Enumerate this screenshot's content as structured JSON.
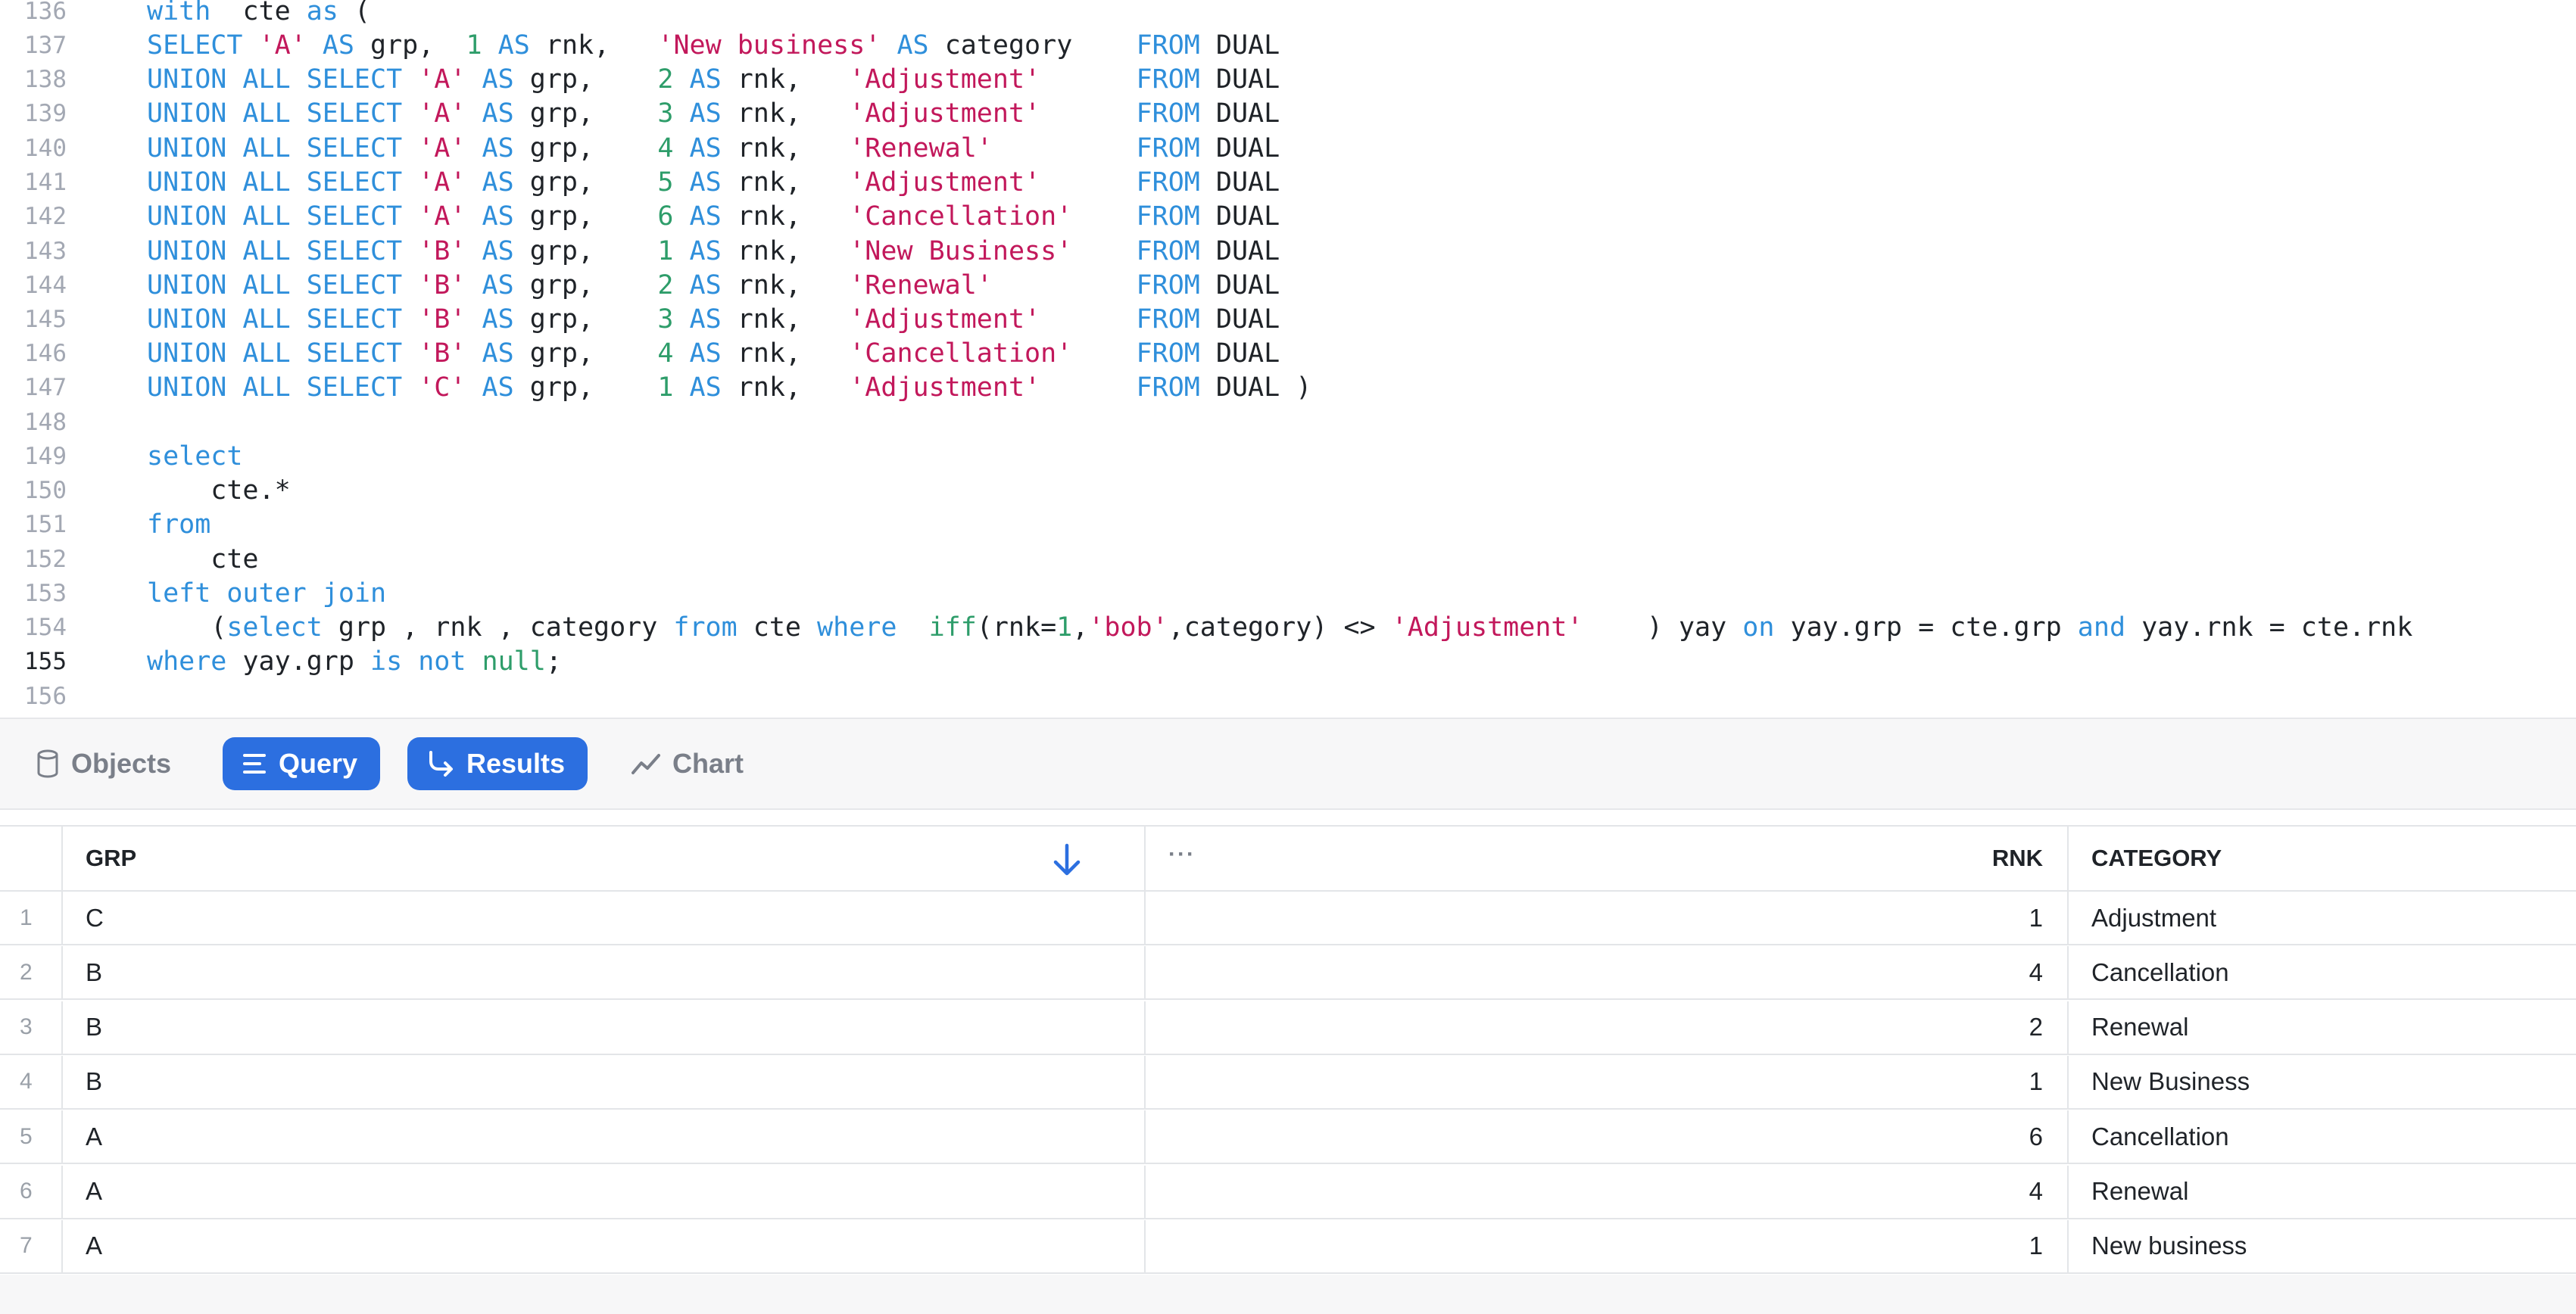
{
  "editor": {
    "lines": [
      {
        "n": "136",
        "tokens": [
          [
            "kw",
            "with"
          ],
          [
            "",
            "  cte "
          ],
          [
            "kw",
            "as"
          ],
          [
            "",
            " ("
          ]
        ]
      },
      {
        "n": "137",
        "tokens": [
          [
            "kw",
            "SELECT"
          ],
          [
            "",
            " "
          ],
          [
            "str",
            "'A'"
          ],
          [
            "",
            " "
          ],
          [
            "kw",
            "AS"
          ],
          [
            "",
            " grp,  "
          ],
          [
            "num",
            "1"
          ],
          [
            "",
            " "
          ],
          [
            "kw",
            "AS"
          ],
          [
            "",
            " rnk,   "
          ],
          [
            "str",
            "'New business'"
          ],
          [
            "",
            " "
          ],
          [
            "kw",
            "AS"
          ],
          [
            "",
            " category    "
          ],
          [
            "kw",
            "FROM"
          ],
          [
            "",
            " DUAL"
          ]
        ]
      },
      {
        "n": "138",
        "tokens": [
          [
            "kw",
            "UNION ALL SELECT"
          ],
          [
            "",
            " "
          ],
          [
            "str",
            "'A'"
          ],
          [
            "",
            " "
          ],
          [
            "kw",
            "AS"
          ],
          [
            "",
            " grp,    "
          ],
          [
            "num",
            "2"
          ],
          [
            "",
            " "
          ],
          [
            "kw",
            "AS"
          ],
          [
            "",
            " rnk,   "
          ],
          [
            "str",
            "'Adjustment'"
          ],
          [
            "",
            "      "
          ],
          [
            "kw",
            "FROM"
          ],
          [
            "",
            " DUAL"
          ]
        ]
      },
      {
        "n": "139",
        "tokens": [
          [
            "kw",
            "UNION ALL SELECT"
          ],
          [
            "",
            " "
          ],
          [
            "str",
            "'A'"
          ],
          [
            "",
            " "
          ],
          [
            "kw",
            "AS"
          ],
          [
            "",
            " grp,    "
          ],
          [
            "num",
            "3"
          ],
          [
            "",
            " "
          ],
          [
            "kw",
            "AS"
          ],
          [
            "",
            " rnk,   "
          ],
          [
            "str",
            "'Adjustment'"
          ],
          [
            "",
            "      "
          ],
          [
            "kw",
            "FROM"
          ],
          [
            "",
            " DUAL"
          ]
        ]
      },
      {
        "n": "140",
        "tokens": [
          [
            "kw",
            "UNION ALL SELECT"
          ],
          [
            "",
            " "
          ],
          [
            "str",
            "'A'"
          ],
          [
            "",
            " "
          ],
          [
            "kw",
            "AS"
          ],
          [
            "",
            " grp,    "
          ],
          [
            "num",
            "4"
          ],
          [
            "",
            " "
          ],
          [
            "kw",
            "AS"
          ],
          [
            "",
            " rnk,   "
          ],
          [
            "str",
            "'Renewal'"
          ],
          [
            "",
            "         "
          ],
          [
            "kw",
            "FROM"
          ],
          [
            "",
            " DUAL"
          ]
        ]
      },
      {
        "n": "141",
        "tokens": [
          [
            "kw",
            "UNION ALL SELECT"
          ],
          [
            "",
            " "
          ],
          [
            "str",
            "'A'"
          ],
          [
            "",
            " "
          ],
          [
            "kw",
            "AS"
          ],
          [
            "",
            " grp,    "
          ],
          [
            "num",
            "5"
          ],
          [
            "",
            " "
          ],
          [
            "kw",
            "AS"
          ],
          [
            "",
            " rnk,   "
          ],
          [
            "str",
            "'Adjustment'"
          ],
          [
            "",
            "      "
          ],
          [
            "kw",
            "FROM"
          ],
          [
            "",
            " DUAL"
          ]
        ]
      },
      {
        "n": "142",
        "tokens": [
          [
            "kw",
            "UNION ALL SELECT"
          ],
          [
            "",
            " "
          ],
          [
            "str",
            "'A'"
          ],
          [
            "",
            " "
          ],
          [
            "kw",
            "AS"
          ],
          [
            "",
            " grp,    "
          ],
          [
            "num",
            "6"
          ],
          [
            "",
            " "
          ],
          [
            "kw",
            "AS"
          ],
          [
            "",
            " rnk,   "
          ],
          [
            "str",
            "'Cancellation'"
          ],
          [
            "",
            "    "
          ],
          [
            "kw",
            "FROM"
          ],
          [
            "",
            " DUAL"
          ]
        ]
      },
      {
        "n": "143",
        "tokens": [
          [
            "kw",
            "UNION ALL SELECT"
          ],
          [
            "",
            " "
          ],
          [
            "str",
            "'B'"
          ],
          [
            "",
            " "
          ],
          [
            "kw",
            "AS"
          ],
          [
            "",
            " grp,    "
          ],
          [
            "num",
            "1"
          ],
          [
            "",
            " "
          ],
          [
            "kw",
            "AS"
          ],
          [
            "",
            " rnk,   "
          ],
          [
            "str",
            "'New Business'"
          ],
          [
            "",
            "    "
          ],
          [
            "kw",
            "FROM"
          ],
          [
            "",
            " DUAL"
          ]
        ]
      },
      {
        "n": "144",
        "tokens": [
          [
            "kw",
            "UNION ALL SELECT"
          ],
          [
            "",
            " "
          ],
          [
            "str",
            "'B'"
          ],
          [
            "",
            " "
          ],
          [
            "kw",
            "AS"
          ],
          [
            "",
            " grp,    "
          ],
          [
            "num",
            "2"
          ],
          [
            "",
            " "
          ],
          [
            "kw",
            "AS"
          ],
          [
            "",
            " rnk,   "
          ],
          [
            "str",
            "'Renewal'"
          ],
          [
            "",
            "         "
          ],
          [
            "kw",
            "FROM"
          ],
          [
            "",
            " DUAL"
          ]
        ]
      },
      {
        "n": "145",
        "tokens": [
          [
            "kw",
            "UNION ALL SELECT"
          ],
          [
            "",
            " "
          ],
          [
            "str",
            "'B'"
          ],
          [
            "",
            " "
          ],
          [
            "kw",
            "AS"
          ],
          [
            "",
            " grp,    "
          ],
          [
            "num",
            "3"
          ],
          [
            "",
            " "
          ],
          [
            "kw",
            "AS"
          ],
          [
            "",
            " rnk,   "
          ],
          [
            "str",
            "'Adjustment'"
          ],
          [
            "",
            "      "
          ],
          [
            "kw",
            "FROM"
          ],
          [
            "",
            " DUAL"
          ]
        ]
      },
      {
        "n": "146",
        "tokens": [
          [
            "kw",
            "UNION ALL SELECT"
          ],
          [
            "",
            " "
          ],
          [
            "str",
            "'B'"
          ],
          [
            "",
            " "
          ],
          [
            "kw",
            "AS"
          ],
          [
            "",
            " grp,    "
          ],
          [
            "num",
            "4"
          ],
          [
            "",
            " "
          ],
          [
            "kw",
            "AS"
          ],
          [
            "",
            " rnk,   "
          ],
          [
            "str",
            "'Cancellation'"
          ],
          [
            "",
            "    "
          ],
          [
            "kw",
            "FROM"
          ],
          [
            "",
            " DUAL"
          ]
        ]
      },
      {
        "n": "147",
        "tokens": [
          [
            "kw",
            "UNION ALL SELECT"
          ],
          [
            "",
            " "
          ],
          [
            "str",
            "'C'"
          ],
          [
            "",
            " "
          ],
          [
            "kw",
            "AS"
          ],
          [
            "",
            " grp,    "
          ],
          [
            "num",
            "1"
          ],
          [
            "",
            " "
          ],
          [
            "kw",
            "AS"
          ],
          [
            "",
            " rnk,   "
          ],
          [
            "str",
            "'Adjustment'"
          ],
          [
            "",
            "      "
          ],
          [
            "kw",
            "FROM"
          ],
          [
            "",
            " DUAL )"
          ]
        ]
      },
      {
        "n": "148",
        "tokens": []
      },
      {
        "n": "149",
        "tokens": [
          [
            "kw",
            "select"
          ]
        ]
      },
      {
        "n": "150",
        "tokens": [
          [
            "",
            "    cte.*"
          ]
        ]
      },
      {
        "n": "151",
        "tokens": [
          [
            "kw",
            "from"
          ]
        ]
      },
      {
        "n": "152",
        "tokens": [
          [
            "",
            "    cte"
          ]
        ]
      },
      {
        "n": "153",
        "tokens": [
          [
            "kw",
            "left outer join"
          ]
        ]
      },
      {
        "n": "154",
        "tokens": [
          [
            "",
            "    ("
          ],
          [
            "kw",
            "select"
          ],
          [
            "",
            " grp , rnk , category "
          ],
          [
            "kw",
            "from"
          ],
          [
            "",
            " cte "
          ],
          [
            "kw",
            "where"
          ],
          [
            "",
            "  "
          ],
          [
            "fn",
            "iff"
          ],
          [
            "",
            "(rnk="
          ],
          [
            "num",
            "1"
          ],
          [
            "",
            ","
          ],
          [
            "str",
            "'bob'"
          ],
          [
            "",
            ",category) <> "
          ],
          [
            "str",
            "'Adjustment'"
          ],
          [
            "",
            "    ) yay "
          ],
          [
            "kw",
            "on"
          ],
          [
            "",
            " yay.grp = cte.grp "
          ],
          [
            "kw",
            "and"
          ],
          [
            "",
            " yay.rnk = cte.rnk"
          ]
        ]
      },
      {
        "n": "155",
        "active": true,
        "tokens": [
          [
            "kw",
            "where"
          ],
          [
            "",
            " yay.grp "
          ],
          [
            "kw",
            "is not"
          ],
          [
            "",
            " "
          ],
          [
            "fn",
            "null"
          ],
          [
            "",
            ";"
          ]
        ]
      },
      {
        "n": "156",
        "tokens": []
      }
    ]
  },
  "toolbar": {
    "objects_label": "Objects",
    "query_label": "Query",
    "results_label": "Results",
    "chart_label": "Chart",
    "icons": [
      "database-icon",
      "query-lines-icon",
      "results-arrow-icon",
      "chart-line-icon"
    ]
  },
  "results": {
    "headers": {
      "grp": "GRP",
      "rnk": "RNK",
      "category": "CATEGORY",
      "more": "···"
    },
    "sort_icon": "arrow-down-icon",
    "rows": [
      {
        "idx": "1",
        "grp": "C",
        "rnk": "1",
        "category": "Adjustment"
      },
      {
        "idx": "2",
        "grp": "B",
        "rnk": "4",
        "category": "Cancellation"
      },
      {
        "idx": "3",
        "grp": "B",
        "rnk": "2",
        "category": "Renewal"
      },
      {
        "idx": "4",
        "grp": "B",
        "rnk": "1",
        "category": "New Business"
      },
      {
        "idx": "5",
        "grp": "A",
        "rnk": "6",
        "category": "Cancellation"
      },
      {
        "idx": "6",
        "grp": "A",
        "rnk": "4",
        "category": "Renewal"
      },
      {
        "idx": "7",
        "grp": "A",
        "rnk": "1",
        "category": "New business"
      }
    ]
  },
  "colors": {
    "accent": "#2c6fe0",
    "keyword": "#2f8fdb",
    "string": "#c2185b",
    "number": "#2e9d6a"
  }
}
